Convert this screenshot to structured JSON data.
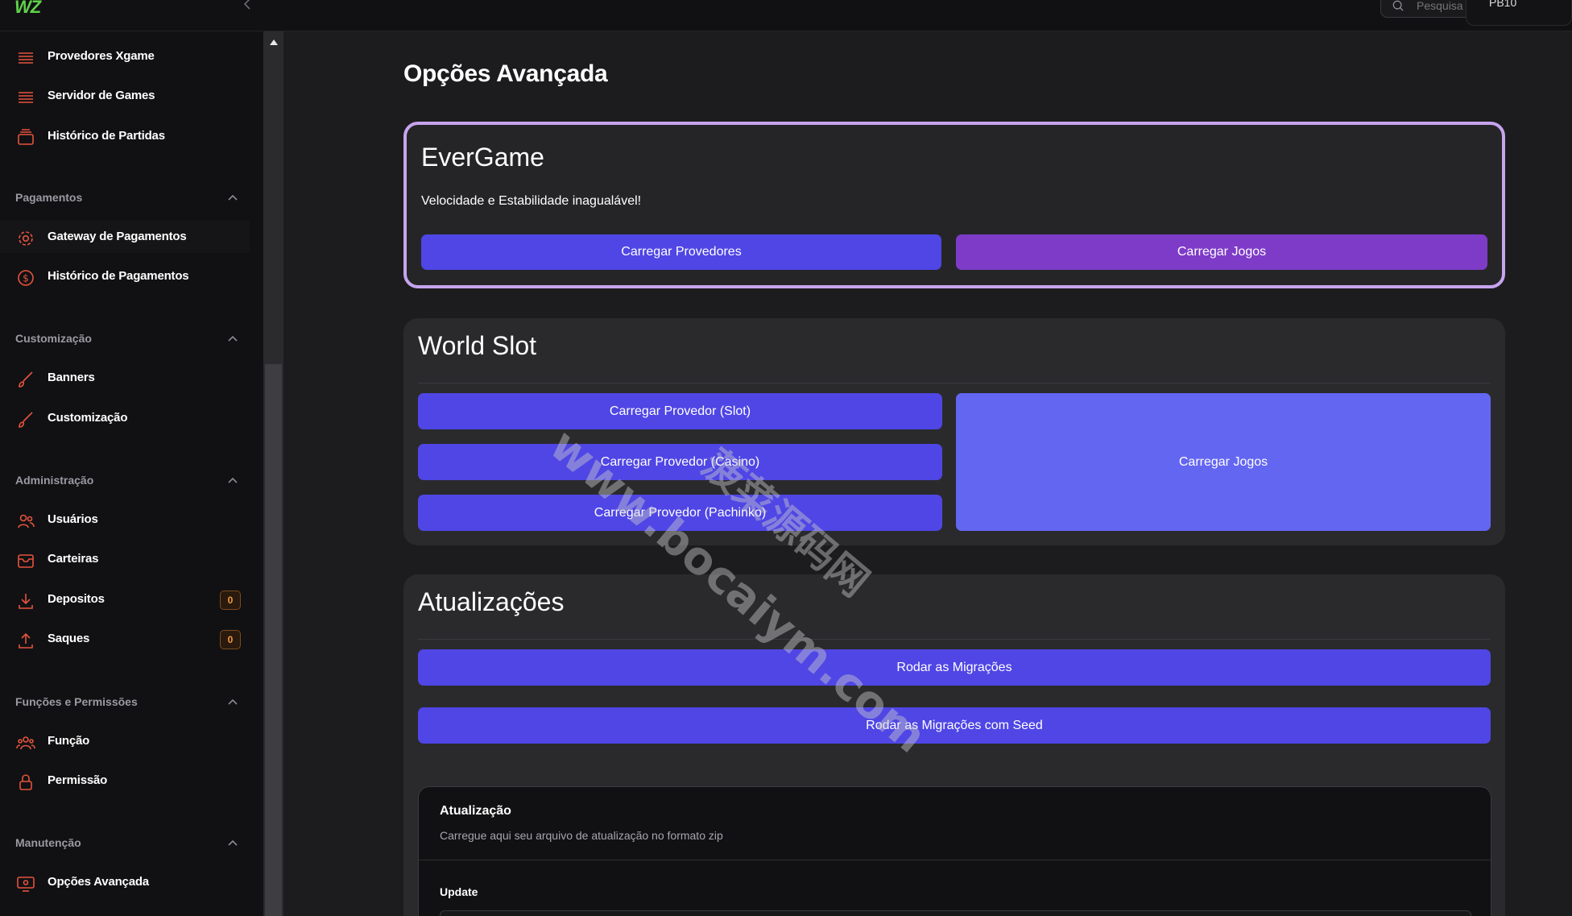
{
  "topbar": {
    "logo": "WZ",
    "search_placeholder": "Pesquisa",
    "user_label": "PB10"
  },
  "sidebar": {
    "items_top": [
      {
        "label": "Provedores Xgame",
        "icon": "list-icon"
      },
      {
        "label": "Servidor de Games",
        "icon": "list-icon"
      },
      {
        "label": "Histórico de Partidas",
        "icon": "archive-icon"
      }
    ],
    "groups": [
      {
        "title": "Pagamentos",
        "items": [
          {
            "label": "Gateway de Pagamentos",
            "icon": "gear-icon"
          },
          {
            "label": "Histórico de Pagamentos",
            "icon": "dollar-circle-icon"
          }
        ]
      },
      {
        "title": "Customização",
        "items": [
          {
            "label": "Banners",
            "icon": "brush-icon"
          },
          {
            "label": "Customização",
            "icon": "brush-icon"
          }
        ]
      },
      {
        "title": "Administração",
        "items": [
          {
            "label": "Usuários",
            "icon": "users-icon"
          },
          {
            "label": "Carteiras",
            "icon": "inbox-icon"
          },
          {
            "label": "Depositos",
            "icon": "download-icon",
            "badge": "0"
          },
          {
            "label": "Saques",
            "icon": "upload-icon",
            "badge": "0"
          }
        ]
      },
      {
        "title": "Funções e Permissões",
        "items": [
          {
            "label": "Função",
            "icon": "user-group-icon"
          },
          {
            "label": "Permissão",
            "icon": "lock-icon"
          }
        ]
      },
      {
        "title": "Manutenção",
        "items": [
          {
            "label": "Opções Avançada",
            "icon": "monitor-icon"
          }
        ]
      }
    ]
  },
  "main": {
    "page_title": "Opções Avançada",
    "evergame": {
      "title": "EverGame",
      "subtitle": "Velocidade e Estabilidade inagualável!",
      "btn_providers": "Carregar Provedores",
      "btn_games": "Carregar Jogos"
    },
    "worldslot": {
      "title": "World Slot",
      "btn_slot": "Carregar Provedor (Slot)",
      "btn_casino": "Carregar Provedor (Casino)",
      "btn_pachinko": "Carregar Provedor (Pachinko)",
      "btn_games": "Carregar Jogos"
    },
    "updates": {
      "title": "Atualizações",
      "btn_migrations": "Rodar as Migrações",
      "btn_migrations_seed": "Rodar as Migrações com Seed",
      "panel_title": "Atualização",
      "panel_desc": "Carregue aqui seu arquivo de atualização no formato zip",
      "field_label": "Update"
    }
  },
  "watermark": {
    "line1": "www.bocaiym.com",
    "line2": "菠菜源码网"
  },
  "colors": {
    "accent_indigo": "#4f46e5",
    "accent_purple": "#7e3bc8",
    "accent_light_indigo": "#6366f1",
    "sidebar_icon": "#e5533d",
    "badge": "#f39b3d"
  }
}
